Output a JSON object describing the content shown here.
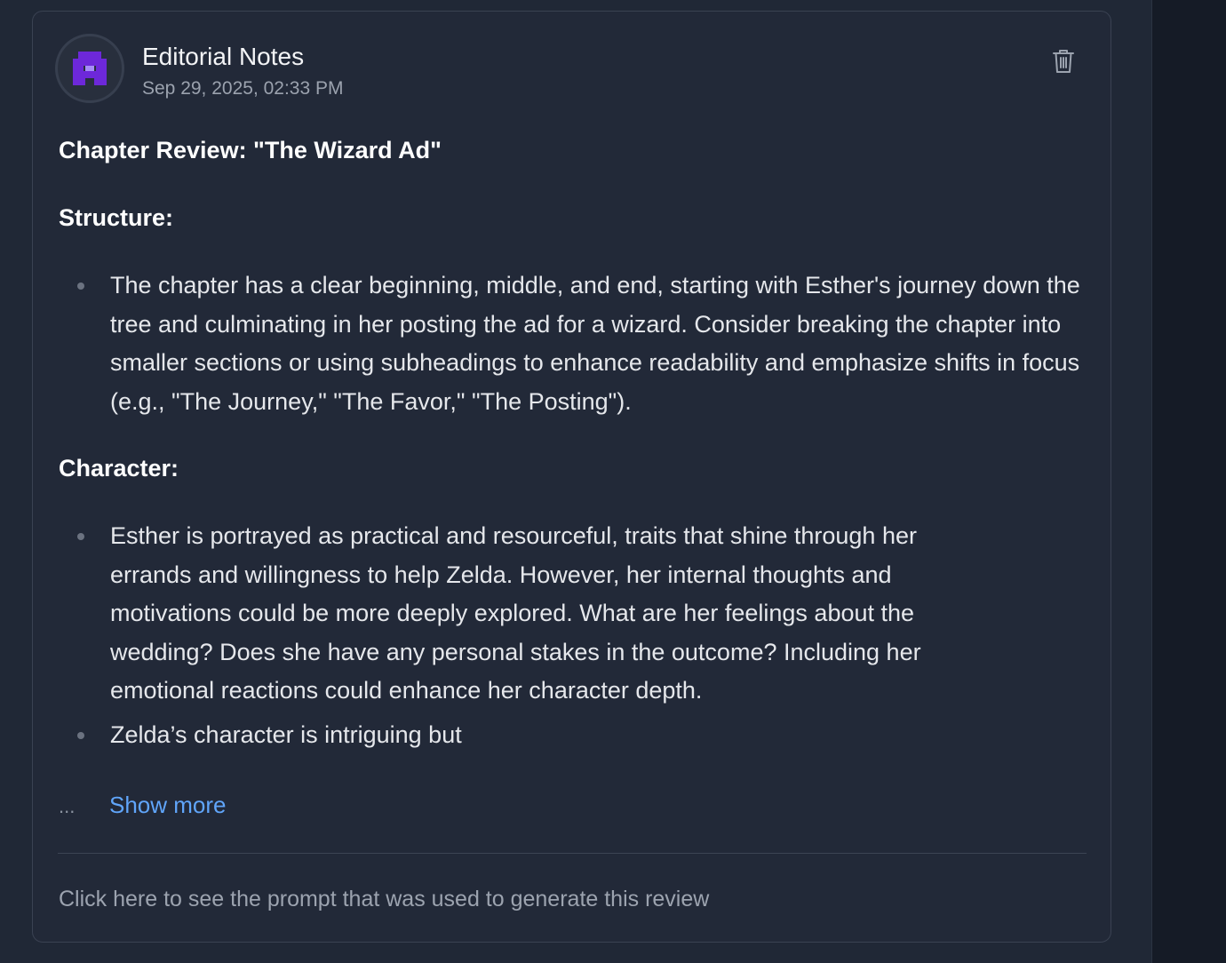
{
  "review": {
    "author": "Editorial Notes",
    "date": "Sep 29, 2025, 02:33 PM",
    "avatar_icon": "pixel-avatar-icon",
    "avatar_color": "#6d28d9",
    "delete_icon": "trash-icon",
    "title": "Chapter Review: \"The Wizard Ad\"",
    "sections": [
      {
        "heading": "Structure:",
        "items": [
          "The chapter has a clear beginning, middle, and end, starting with Esther's journey down the tree and culminating in her posting the ad for a wizard. Consider breaking the chapter into smaller sections or using subheadings to enhance readability and emphasize shifts in focus (e.g., \"The Journey,\" \"The Favor,\" \"The Posting\")."
        ]
      },
      {
        "heading": "Character:",
        "items": [
          "Esther is portrayed as practical and resourceful, traits that shine through her errands and willingness to help Zelda. However, her internal thoughts and motivations could be more deeply explored. What are her feelings about the wedding? Does she have any personal stakes in the outcome? Including her emotional reactions could enhance her character depth.",
          "Zelda’s character is intriguing but"
        ]
      }
    ],
    "ellipsis": "...",
    "show_more_label": "Show more",
    "prompt_link_label": "Click here to see the prompt that was used to generate this review",
    "link_color": "#60a5fa"
  }
}
